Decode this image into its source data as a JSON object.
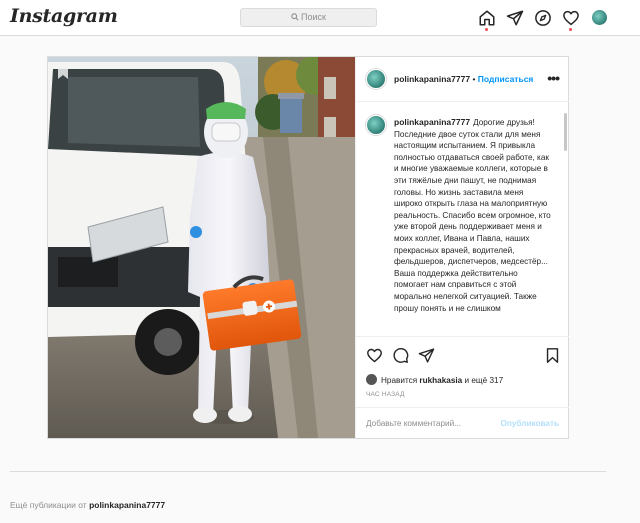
{
  "app": {
    "logo": "Instagram"
  },
  "search": {
    "placeholder": "Поиск"
  },
  "nav": {
    "icons": [
      "home-icon",
      "direct-icon",
      "explore-icon",
      "activity-heart-icon",
      "profile-avatar-icon"
    ]
  },
  "post": {
    "username": "polinkapanina7777",
    "separator": "•",
    "follow_label": "Подписаться",
    "more_label": "•••",
    "caption_text": "Дорогие друзья! Последние двое суток стали для меня настоящим испытанием. Я привыкла полностью отдаваться своей работе, как и многие уважаемые коллеги, которые в эти тяжёлые дни пашут, не поднимая головы. Но жизнь заставила меня широко открыть глаза на малоприятную реальность. Спасибо всем огромное, кто уже второй день поддерживает меня и моих коллег, Ивана и Павла, наших прекрасных врачей, водителей, фельдшеров, диспетчеров, медсестёр... Ваша поддержка действительно помогает нам справиться с этой морально нелегкой ситуацией. Также прошу понять и не слишком",
    "likes_prefix": "Нравится",
    "likes_user": "rukhakasia",
    "likes_suffix": "и ещё 317",
    "time": "ЧАС НАЗАД",
    "comment_placeholder": "Добавьте комментарий...",
    "publish_label": "Опубликовать"
  },
  "more_posts": {
    "prefix": "Ещё публикации от",
    "username": "polinkapanina7777"
  },
  "colors": {
    "accent": "#0095f6",
    "notify": "#ed4956",
    "border": "#dbdbdb"
  }
}
